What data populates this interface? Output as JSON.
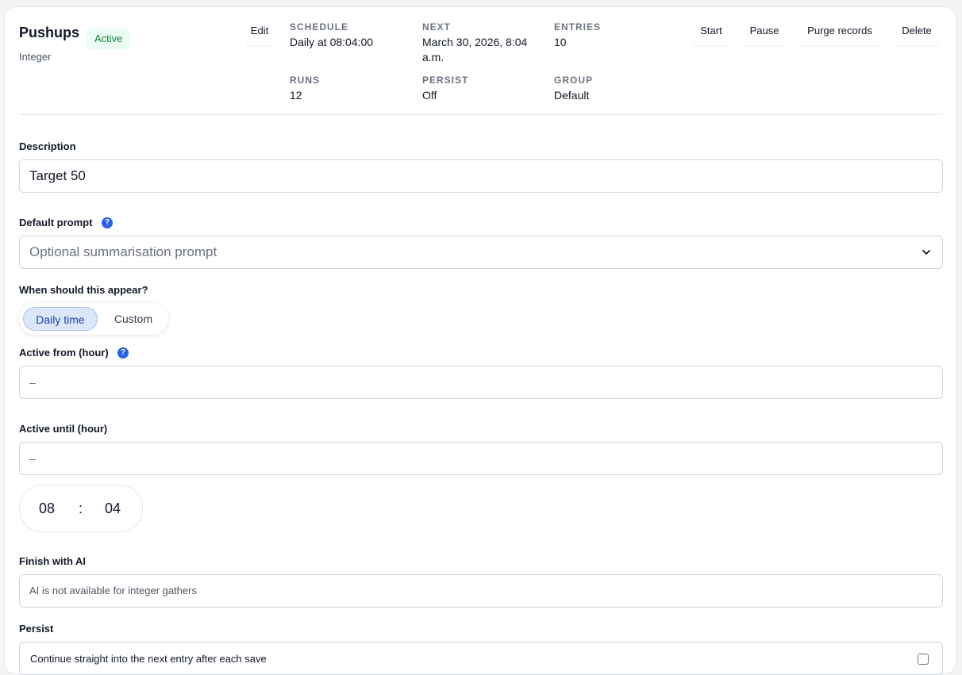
{
  "header": {
    "title": "Pushups",
    "status_badge": "Active",
    "subtitle": "Integer",
    "edit_label": "Edit"
  },
  "stats": {
    "schedule": {
      "label": "SCHEDULE",
      "value": "Daily at 08:04:00"
    },
    "next": {
      "label": "NEXT",
      "value_line1": "March 30, 2026, 8:04",
      "value_line2": "a.m."
    },
    "entries": {
      "label": "ENTRIES",
      "value": "10"
    },
    "runs": {
      "label": "RUNS",
      "value": "12"
    },
    "persist": {
      "label": "PERSIST",
      "value": "Off"
    },
    "group": {
      "label": "GROUP",
      "value": "Default"
    }
  },
  "actions": {
    "start": "Start",
    "pause": "Pause",
    "purge": "Purge records",
    "delete": "Delete"
  },
  "form": {
    "description": {
      "label": "Description",
      "value": "Target 50"
    },
    "default_prompt": {
      "label": "Default prompt",
      "help": "?",
      "placeholder": "Optional summarisation prompt"
    },
    "appear": {
      "label": "When should this appear?",
      "options": [
        "Daily time",
        "Custom"
      ],
      "selected": "Daily time"
    },
    "active_from": {
      "label": "Active from (hour)",
      "help": "?",
      "value": "–"
    },
    "active_until": {
      "label": "Active until (hour)",
      "value": "–"
    },
    "time": {
      "hour": "08",
      "separator": ":",
      "minute": "04"
    },
    "finish_ai": {
      "label": "Finish with AI",
      "value": "AI is not available for integer gathers"
    },
    "persist": {
      "label": "Persist",
      "option": "Continue straight into the next entry after each save",
      "checked": false
    }
  },
  "colors": {
    "badge_bg": "#ecfdf3",
    "badge_text": "#15803d",
    "help_icon": "#2563eb",
    "segment_active_bg": "#dbe7fb"
  },
  "icons": {
    "help": "question-circle-icon",
    "dropdown": "chevron-down-icon"
  }
}
